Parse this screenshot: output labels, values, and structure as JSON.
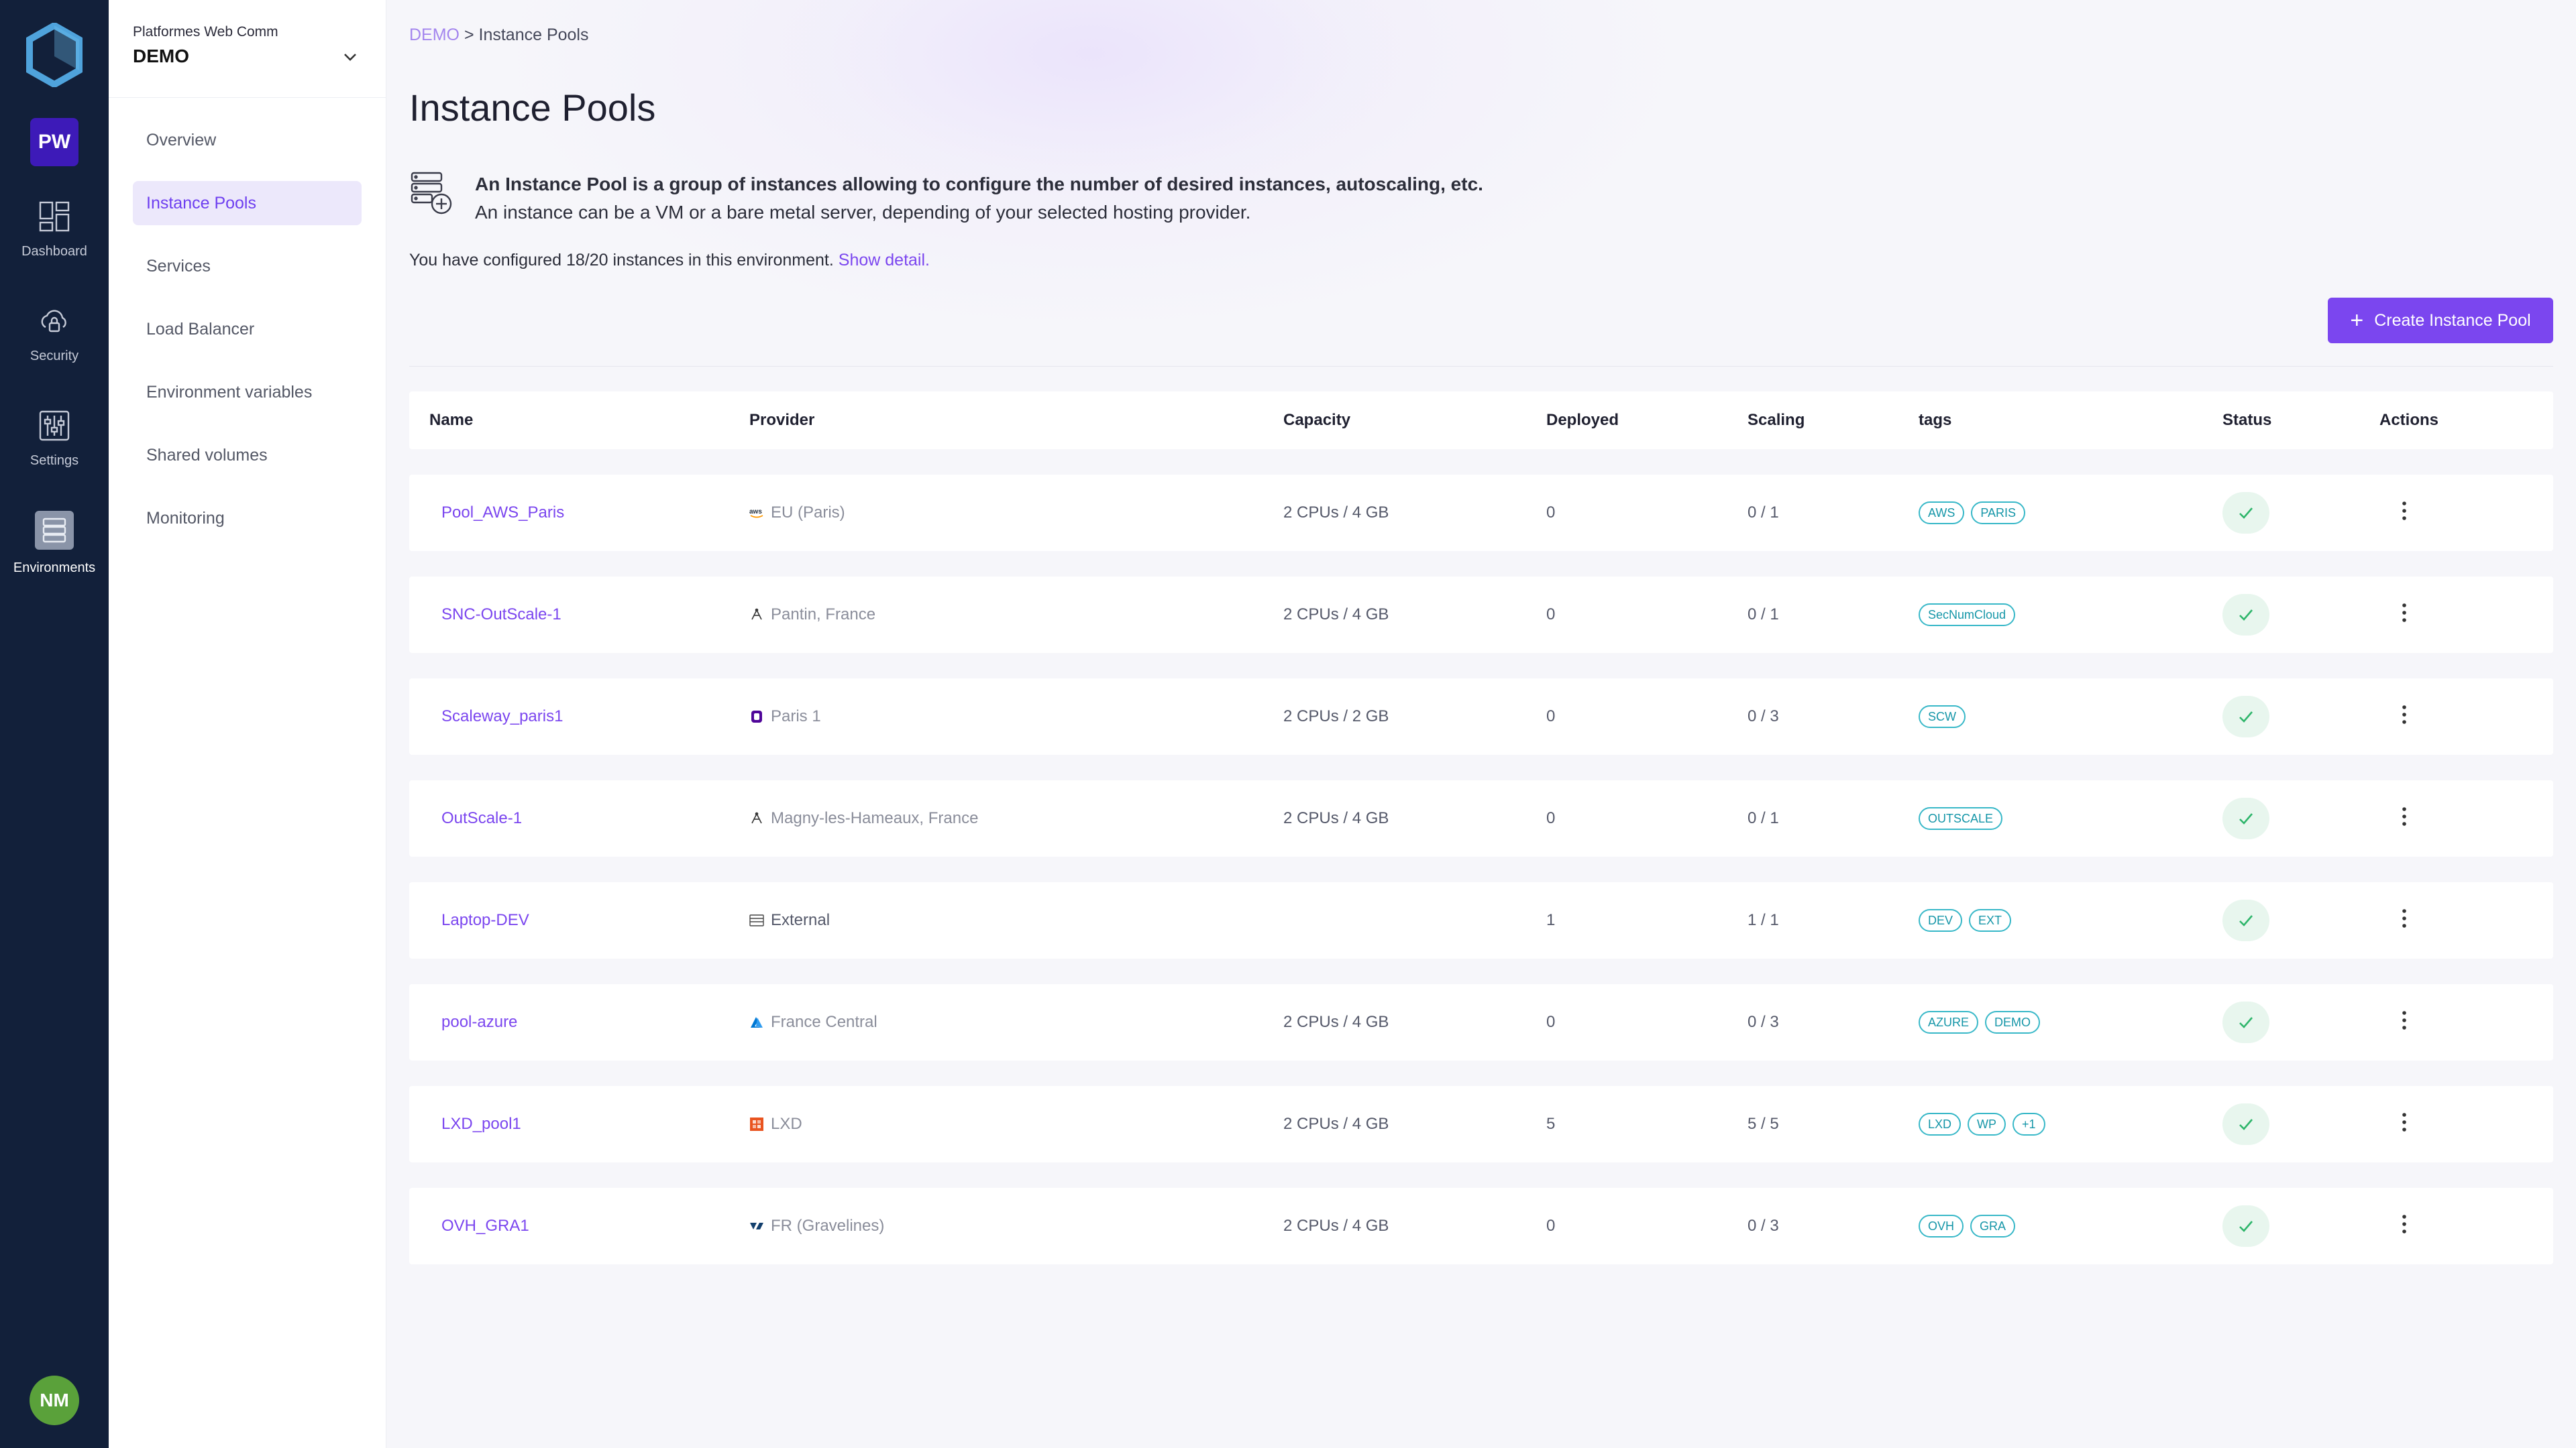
{
  "rail": {
    "org_badge": "PW",
    "items": [
      {
        "label": "Dashboard",
        "icon": "dashboard-icon"
      },
      {
        "label": "Security",
        "icon": "lock-cloud-icon"
      },
      {
        "label": "Settings",
        "icon": "sliders-icon"
      },
      {
        "label": "Environments",
        "icon": "server-stack-icon",
        "active": true
      }
    ],
    "avatar": "NM"
  },
  "subnav": {
    "org": "Platformes Web Comm",
    "env": "DEMO",
    "items": [
      {
        "label": "Overview"
      },
      {
        "label": "Instance Pools",
        "active": true
      },
      {
        "label": "Services"
      },
      {
        "label": "Load Balancer"
      },
      {
        "label": "Environment variables"
      },
      {
        "label": "Shared volumes"
      },
      {
        "label": "Monitoring"
      }
    ]
  },
  "breadcrumb": {
    "link": "DEMO",
    "sep": " > ",
    "current": "Instance Pools"
  },
  "page_title": "Instance Pools",
  "info": {
    "line1": "An Instance Pool is a group of instances allowing to configure the number of desired instances, autoscaling, etc.",
    "line2": "An instance can be a VM or a bare metal server, depending of your selected hosting provider."
  },
  "quota": {
    "text": "You have configured 18/20 instances in this environment. ",
    "link": "Show detail."
  },
  "create_button": "Create Instance Pool",
  "table": {
    "headers": {
      "name": "Name",
      "provider": "Provider",
      "capacity": "Capacity",
      "deployed": "Deployed",
      "scaling": "Scaling",
      "tags": "tags",
      "status": "Status",
      "actions": "Actions"
    },
    "rows": [
      {
        "name": "Pool_AWS_Paris",
        "provider_icon": "aws-icon",
        "provider": "EU (Paris)",
        "capacity": "2 CPUs / 4 GB",
        "deployed": "0",
        "scaling": "0 / 1",
        "tags": [
          "AWS",
          "PARIS"
        ]
      },
      {
        "name": "SNC-OutScale-1",
        "provider_icon": "outscale-icon",
        "provider": "Pantin, France",
        "capacity": "2 CPUs / 4 GB",
        "deployed": "0",
        "scaling": "0 / 1",
        "tags": [
          "SecNumCloud"
        ]
      },
      {
        "name": "Scaleway_paris1",
        "provider_icon": "scaleway-icon",
        "provider": "Paris 1",
        "capacity": "2 CPUs / 2 GB",
        "deployed": "0",
        "scaling": "0 / 3",
        "tags": [
          "SCW"
        ]
      },
      {
        "name": "OutScale-1",
        "provider_icon": "outscale-icon",
        "provider": "Magny-les-Hameaux, France",
        "capacity": "2 CPUs / 4 GB",
        "deployed": "0",
        "scaling": "0 / 1",
        "tags": [
          "OUTSCALE"
        ]
      },
      {
        "name": "Laptop-DEV",
        "provider_icon": "server-icon",
        "provider": "External",
        "capacity": "",
        "deployed": "1",
        "scaling": "1 / 1",
        "tags": [
          "DEV",
          "EXT"
        ]
      },
      {
        "name": "pool-azure",
        "provider_icon": "azure-icon",
        "provider": "France Central",
        "capacity": "2 CPUs / 4 GB",
        "deployed": "0",
        "scaling": "0 / 3",
        "tags": [
          "AZURE",
          "DEMO"
        ]
      },
      {
        "name": "LXD_pool1",
        "provider_icon": "lxd-icon",
        "provider": "LXD",
        "capacity": "2 CPUs / 4 GB",
        "deployed": "5",
        "scaling": "5 / 5",
        "tags": [
          "LXD",
          "WP",
          "+1"
        ]
      },
      {
        "name": "OVH_GRA1",
        "provider_icon": "ovh-icon",
        "provider": "FR (Gravelines)",
        "capacity": "2 CPUs / 4 GB",
        "deployed": "0",
        "scaling": "0 / 3",
        "tags": [
          "OVH",
          "GRA"
        ]
      }
    ]
  },
  "colors": {
    "accent": "#7b46ef",
    "rail_bg": "#12203a",
    "tag": "#38b8c8",
    "ok": "#2db56a"
  }
}
